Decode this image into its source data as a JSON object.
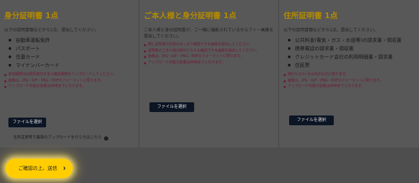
{
  "cards": [
    {
      "title": "身分証明書 1点",
      "intro": "以下の証明書類などから1点、提出してください。",
      "docs": [
        "自動車運転免許",
        "パスポート",
        "住基カード",
        "マイナンバーカード"
      ],
      "notes": [
        "有効期限内の顔写真付き本人確認書類をアップロードしてください。",
        "画像は、JPG・GIF・PNG・PDFのフォーマットに限ります。",
        "アップロード可能な容量は5MBまでとなります。"
      ],
      "button": "ファイルを選択",
      "link": "住所変更等で裏面のアップロードを行う方はこちら",
      "link_icon": "arrow-icon"
    },
    {
      "title": "ご本人様と身分証明書 1点",
      "intro": "ご本人様と身分証明書が、ご一緒に撮影されているセルフィー画像を提出してください。",
      "notes": [
        "顔と証明書の内容がはっきり確認できる画像を提出してください。",
        "証明書のご本人様の顔がどちらも確認できる画像を提出してください。",
        "画像は、JPG・GIF・PNG・PDFのフォーマットに限ります。",
        "アップロード可能な容量は5MBまでとなります。"
      ],
      "button": "ファイルを選択"
    },
    {
      "title": "住所証明書 1点",
      "intro": "以下の証明書類などから1点、提出してください。",
      "docs": [
        "公共料金(電気・ガス・水道等)の請求書・領収書",
        "携帯電話の請求書・領収書",
        "クレジットカード会社の利用明細書・請求書",
        "住民票"
      ],
      "notes": [
        "発行から3ヶ月以内のものに限ります。",
        "画像は、JPG・GIF・PNG・PDFのフォーマットに限ります。",
        "アップロード可能な容量は5MBまでとなります。"
      ],
      "button": "ファイルを選択"
    }
  ],
  "submit": {
    "label": "ご確認の上、送信",
    "icon": "chevron-right-icon"
  }
}
